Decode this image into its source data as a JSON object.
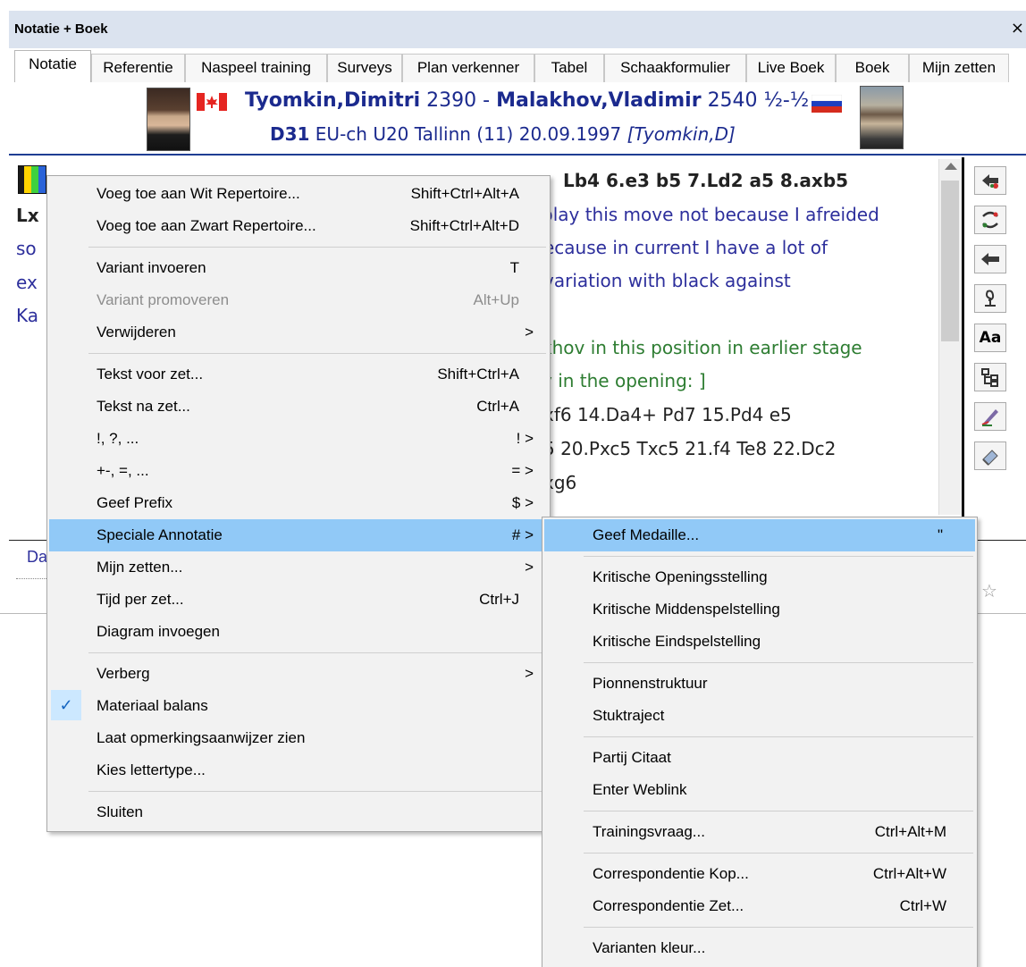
{
  "window": {
    "title": "Notatie + Boek",
    "close_glyph": "×",
    "tabs": [
      "Notatie",
      "Referentie",
      "Naspeel training",
      "Surveys",
      "Plan verkenner",
      "Tabel",
      "Schaakformulier",
      "Live Boek",
      "Boek",
      "Mijn zetten"
    ],
    "active_tab": "Notatie"
  },
  "game_header": {
    "white_name": "Tyomkin,Dimitri",
    "white_elo": "2390",
    "separator": "-",
    "black_name": "Malakhov,Vladimir",
    "black_elo": "2540",
    "result": "½-½",
    "eco": "D31",
    "event": "EU-ch U20 Tallinn (11) 20.09.1997",
    "annotator": "[Tyomkin,D]",
    "white_flag": "canada-flag-icon",
    "black_flag": "russia-flag-icon"
  },
  "notation": {
    "lines": [
      {
        "text": "Lb4  6.e3  b5  7.Ld2  a5  8.axb5",
        "color": "black"
      },
      {
        "text": "play this move not because I afreided",
        "color": "blue"
      },
      {
        "text": "ecause in current I have a lot of",
        "color": "blue"
      },
      {
        "text": "variation with black against",
        "color": "blue"
      },
      {
        "text": "khov in this position in earlier stage",
        "color": "green"
      },
      {
        "text": "y in the opening: ]",
        "color": "green"
      },
      {
        "text": "xf6  14.Da4+  Pd7  15.Pd4  e5",
        "color": "black"
      },
      {
        "text": "5  20.Pxc5  Txc5  21.f4  Te8  22.Dc2",
        "color": "black"
      },
      {
        "text": "xg6",
        "color": "black"
      }
    ],
    "left_fragments": [
      "Lx",
      "so",
      "ex",
      "Ka"
    ]
  },
  "bottom_tab_fragment": "Da",
  "context_menu": {
    "items": [
      {
        "label": "Voeg toe aan Wit Repertoire...",
        "shortcut": "Shift+Ctrl+Alt+A"
      },
      {
        "label": "Voeg toe aan Zwart Repertoire...",
        "shortcut": "Shift+Ctrl+Alt+D"
      },
      {
        "label": "Variant invoeren",
        "shortcut": "T"
      },
      {
        "label": "Variant promoveren",
        "shortcut": "Alt+Up",
        "disabled": true
      },
      {
        "label": "Verwijderen",
        "shortcut": ">"
      },
      {
        "label": "Tekst voor zet...",
        "shortcut": "Shift+Ctrl+A"
      },
      {
        "label": "Tekst na zet...",
        "shortcut": "Ctrl+A"
      },
      {
        "label": "!, ?, ...",
        "shortcut": "! >"
      },
      {
        "label": "+-, =, ...",
        "shortcut": "= >"
      },
      {
        "label": "Geef Prefix",
        "shortcut": "$ >"
      },
      {
        "label": "Speciale Annotatie",
        "shortcut": "# >",
        "highlighted": true
      },
      {
        "label": "Mijn zetten...",
        "shortcut": ">"
      },
      {
        "label": "Tijd per zet...",
        "shortcut": "Ctrl+J"
      },
      {
        "label": "Diagram invoegen",
        "shortcut": ""
      },
      {
        "label": "Verberg",
        "shortcut": ">"
      },
      {
        "label": "Materiaal balans",
        "shortcut": "",
        "checked": true,
        "check_glyph": "✓"
      },
      {
        "label": "Laat opmerkingsaanwijzer zien",
        "shortcut": ""
      },
      {
        "label": "Kies lettertype...",
        "shortcut": ""
      },
      {
        "label": "Sluiten",
        "shortcut": ""
      }
    ]
  },
  "submenu": {
    "items": [
      {
        "label": "Geef Medaille...",
        "shortcut": "\"",
        "highlighted": true
      },
      {
        "label": "Kritische Openingsstelling",
        "shortcut": ""
      },
      {
        "label": "Kritische Middenspelstelling",
        "shortcut": ""
      },
      {
        "label": "Kritische Eindspelstelling",
        "shortcut": ""
      },
      {
        "label": "Pionnenstruktuur",
        "shortcut": ""
      },
      {
        "label": "Stuktraject",
        "shortcut": ""
      },
      {
        "label": "Partij Citaat",
        "shortcut": ""
      },
      {
        "label": "Enter Weblink",
        "shortcut": ""
      },
      {
        "label": "Trainingsvraag...",
        "shortcut": "Ctrl+Alt+M"
      },
      {
        "label": "Correspondentie Kop...",
        "shortcut": "Ctrl+Alt+W"
      },
      {
        "label": "Correspondentie Zet...",
        "shortcut": "Ctrl+W"
      },
      {
        "label": "Varianten kleur...",
        "shortcut": ""
      }
    ]
  },
  "colors": {
    "highlight": "#91c9f7",
    "titlebar": "#dbe3ef",
    "notation_blue": "#2d2f9c",
    "notation_green": "#2e7d32"
  },
  "toolbar_icons": [
    "pin-left-icon",
    "swap-icon",
    "pin-move-icon",
    "knot-icon",
    "font-aa-icon",
    "tree-icon",
    "pen-icon",
    "eraser-icon"
  ],
  "toolbar_font_label": "Aa"
}
